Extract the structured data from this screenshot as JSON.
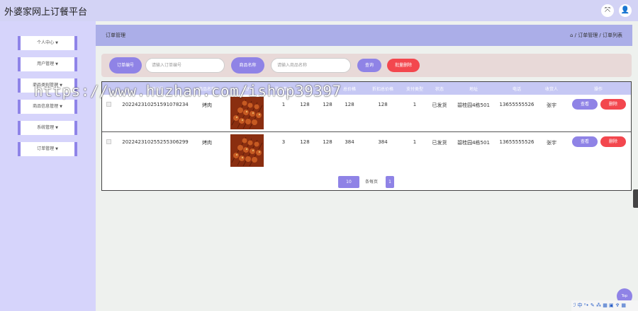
{
  "app": {
    "title": "外婆家网上订餐平台"
  },
  "topbar": {
    "fullscreen_icon": "⤧",
    "user_icon": "👤"
  },
  "sidebar": {
    "items": [
      {
        "label": "个人中心"
      },
      {
        "label": "用户管理"
      },
      {
        "label": "商品类别管理"
      },
      {
        "label": "商品信息管理"
      },
      {
        "label": "系统管理"
      },
      {
        "label": "订单管理"
      }
    ]
  },
  "breadcrumb": {
    "title": "订单管理",
    "path": "⌂ / 订单管理 / 订单列表"
  },
  "search": {
    "order_no_label": "订单编号",
    "order_no_placeholder": "请输入订单编号",
    "goods_name_label": "商品名称",
    "goods_name_placeholder": "请输入商品名称",
    "query_button": "查询",
    "batch_delete_button": "批量删除"
  },
  "table": {
    "columns": [
      "订单编号",
      "商品名称",
      "图片",
      "购买数量",
      "价格",
      "折扣价",
      "总价格",
      "折扣总价格",
      "支付类型",
      "状态",
      "地址",
      "电话",
      "收货人",
      "操作"
    ],
    "rows": [
      {
        "order_no": "2022423102515910782​34",
        "goods_name": "烤肉",
        "qty": "1",
        "price": "128",
        "discount_price": "128",
        "total": "128",
        "discount_total": "128",
        "pay_type": "1",
        "status": "已发货",
        "address": "碧桂园4栋501",
        "phone": "13655555526",
        "receiver": "张宇"
      },
      {
        "order_no": "20224231025525530​6299",
        "goods_name": "烤肉",
        "qty": "3",
        "price": "128",
        "discount_price": "128",
        "total": "384",
        "discount_total": "384",
        "pay_type": "1",
        "status": "已发货",
        "address": "碧桂园4栋501",
        "phone": "13655555526",
        "receiver": "张宇"
      }
    ],
    "view_button": "查看",
    "delete_button": "删除"
  },
  "pagination": {
    "page_size": "10",
    "total_text": "条每页",
    "current_page": "1"
  },
  "watermark": {
    "text": "https://www.huzhan.com/ishop39397"
  },
  "float_button": {
    "label": "Top"
  },
  "ime_bar": {
    "text": "ℐ 中 ⁰• ✎ ⁂ ▦ ▣ ♆ ▦"
  },
  "colors": {
    "accent": "#8f83e6",
    "danger": "#f3474e",
    "sidebar": "#d6d4fb",
    "topbar": "#d3d3f5"
  }
}
